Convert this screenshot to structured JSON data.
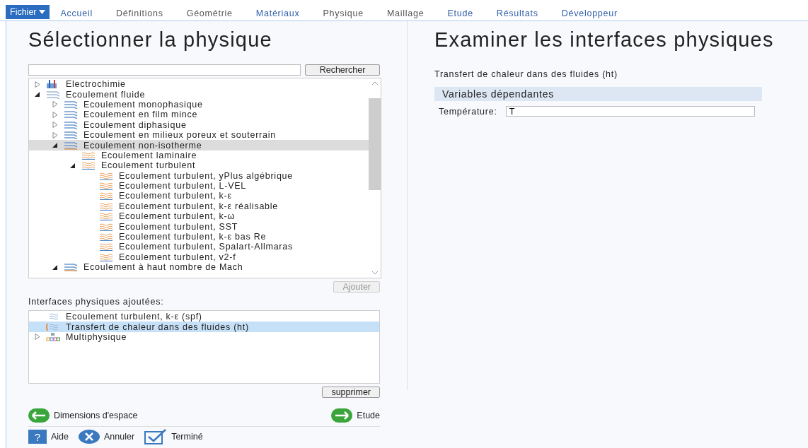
{
  "menu": {
    "file_button": "Fichier",
    "tabs": [
      {
        "label": "Accueil",
        "color": "#2f5ea8"
      },
      {
        "label": "Définitions",
        "color": "#555555"
      },
      {
        "label": "Géométrie",
        "color": "#555555"
      },
      {
        "label": "Matériaux",
        "color": "#2f5ea8"
      },
      {
        "label": "Physique",
        "color": "#555555"
      },
      {
        "label": "Maillage",
        "color": "#555555"
      },
      {
        "label": "Etude",
        "color": "#2f5ea8"
      },
      {
        "label": "Résultats",
        "color": "#2f5ea8"
      },
      {
        "label": "Développeur",
        "color": "#2f5ea8"
      }
    ]
  },
  "select_panel": {
    "title": "Sélectionner la physique",
    "search_button": "Rechercher",
    "tree": [
      {
        "label": "Electrochimie",
        "expanded": false,
        "selected": false
      },
      {
        "label": "Ecoulement fluide",
        "expanded": true,
        "selected": false,
        "children": [
          {
            "label": "Ecoulement monophasique",
            "expanded": false,
            "selected": false
          },
          {
            "label": "Ecoulement en film mince",
            "expanded": false,
            "selected": false
          },
          {
            "label": "Ecoulement diphasique",
            "expanded": false,
            "selected": false
          },
          {
            "label": "Ecoulement en milieux poreux et souterrain",
            "expanded": false,
            "selected": false
          },
          {
            "label": "Ecoulement non-isotherme",
            "expanded": true,
            "selected": true,
            "children": [
              {
                "label": "Ecoulement laminaire",
                "selected": false
              },
              {
                "label": "Ecoulement turbulent",
                "expanded": true,
                "selected": false,
                "children": [
                  {
                    "label": "Ecoulement turbulent, yPlus algébrique",
                    "selected": false
                  },
                  {
                    "label": "Ecoulement turbulent, L-VEL",
                    "selected": false
                  },
                  {
                    "label": "Ecoulement turbulent, k-ε",
                    "selected": false
                  },
                  {
                    "label": "Ecoulement turbulent, k-ε réalisable",
                    "selected": false
                  },
                  {
                    "label": "Ecoulement turbulent, k-ω",
                    "selected": false
                  },
                  {
                    "label": "Ecoulement turbulent, SST",
                    "selected": false
                  },
                  {
                    "label": "Ecoulement turbulent, k-ε bas Re",
                    "selected": false
                  },
                  {
                    "label": "Ecoulement turbulent, Spalart-Allmaras",
                    "selected": false
                  },
                  {
                    "label": "Ecoulement turbulent, v2-f",
                    "selected": false
                  }
                ]
              }
            ]
          },
          {
            "label": "Ecoulement à haut nombre de Mach",
            "expanded": true,
            "selected": false
          }
        ]
      }
    ],
    "add_button": {
      "label": "Ajouter",
      "disabled": true
    },
    "added_label": "Interfaces physiques ajoutées:",
    "added": [
      {
        "label": "Ecoulement turbulent, k-ε (spf)",
        "selected": false
      },
      {
        "label": "Transfert de chaleur dans des fluides (ht)",
        "selected": true
      },
      {
        "label": "Multiphysique",
        "selected": false,
        "expanded": false
      }
    ],
    "remove_button": "supprimer",
    "back_button": "Dimensions d'espace",
    "next_button": "Etude",
    "footer": {
      "help_icon": "?",
      "help": "Aide",
      "cancel": "Annuler",
      "done": "Terminé"
    }
  },
  "review_panel": {
    "title": "Examiner les interfaces physiques",
    "interface": "Transfert de chaleur dans des fluides (ht)",
    "section": "Variables dépendantes",
    "field_label": "Température:",
    "field_value": "T"
  }
}
